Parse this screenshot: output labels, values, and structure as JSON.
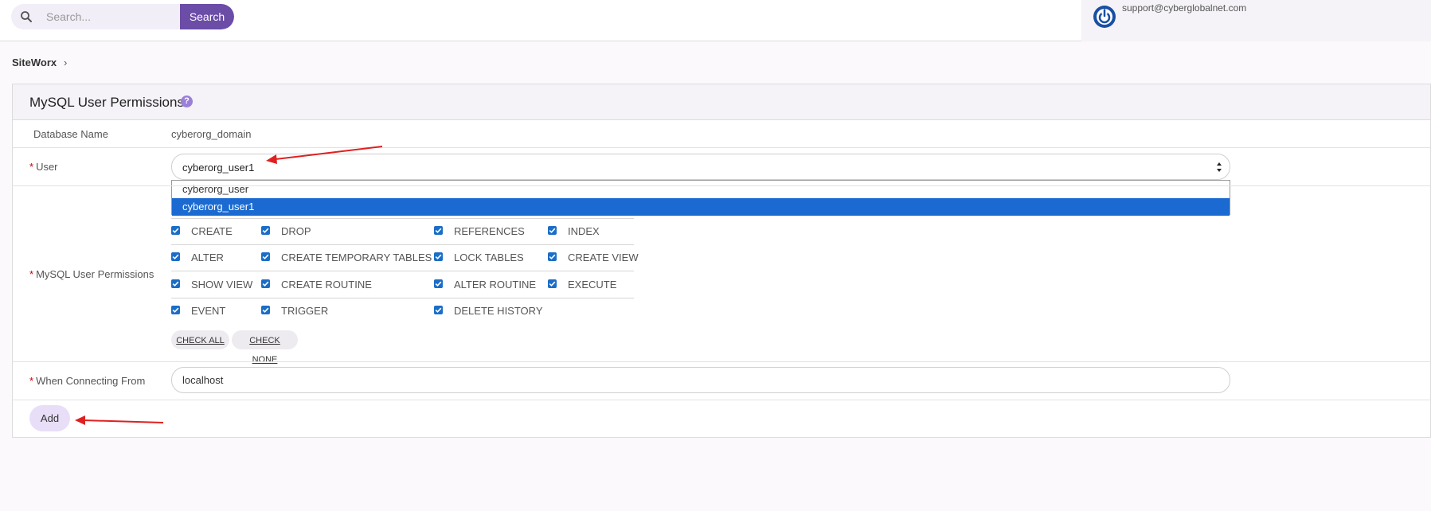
{
  "search": {
    "placeholder": "Search...",
    "button_label": "Search"
  },
  "header": {
    "user_email": "support@cyberglobalnet.com"
  },
  "breadcrumb": {
    "root": "SiteWorx",
    "separator": "›"
  },
  "panel": {
    "title": "MySQL User Permissions",
    "help_glyph": "?",
    "database_label": "Database Name",
    "database_value": "cyberorg_domain",
    "user_label": "User",
    "user_selected": "cyberorg_user1",
    "user_options": [
      "cyberorg_user",
      "cyberorg_user1"
    ],
    "permissions_label": "MySQL User Permissions",
    "permissions": [
      {
        "label": "CREATE",
        "checked": true
      },
      {
        "label": "DROP",
        "checked": true
      },
      {
        "label": "REFERENCES",
        "checked": true
      },
      {
        "label": "INDEX",
        "checked": true
      },
      {
        "label": "ALTER",
        "checked": true
      },
      {
        "label": "CREATE TEMPORARY TABLES",
        "checked": true
      },
      {
        "label": "LOCK TABLES",
        "checked": true
      },
      {
        "label": "CREATE VIEW",
        "checked": true
      },
      {
        "label": "SHOW VIEW",
        "checked": true
      },
      {
        "label": "CREATE ROUTINE",
        "checked": true
      },
      {
        "label": "ALTER ROUTINE",
        "checked": true
      },
      {
        "label": "EXECUTE",
        "checked": true
      },
      {
        "label": "EVENT",
        "checked": true
      },
      {
        "label": "TRIGGER",
        "checked": true
      },
      {
        "label": "DELETE HISTORY",
        "checked": true
      }
    ],
    "check_all_label": "CHECK ALL",
    "check_none_label": "CHECK NONE",
    "connecting_label": "When Connecting From",
    "connecting_value": "localhost",
    "add_label": "Add",
    "required_marker": "*"
  },
  "colors": {
    "accent": "#6b4ca6",
    "checkbox": "#1a6ec7",
    "selected_option": "#1b6ad1",
    "arrow": "#e02020"
  }
}
